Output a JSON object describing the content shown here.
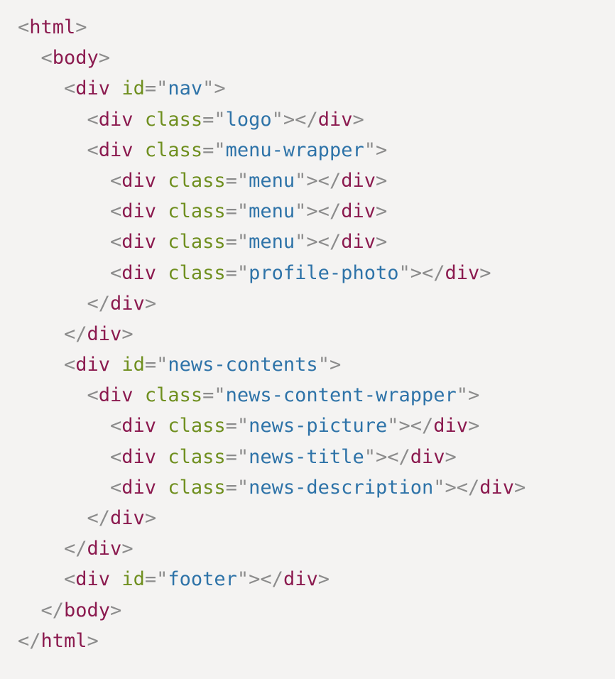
{
  "code": {
    "lines": [
      {
        "indent": 0,
        "tokens": [
          {
            "t": "<",
            "c": "punct"
          },
          {
            "t": "html",
            "c": "tag"
          },
          {
            "t": ">",
            "c": "punct"
          }
        ]
      },
      {
        "indent": 1,
        "tokens": [
          {
            "t": "<",
            "c": "punct"
          },
          {
            "t": "body",
            "c": "tag"
          },
          {
            "t": ">",
            "c": "punct"
          }
        ]
      },
      {
        "indent": 2,
        "tokens": [
          {
            "t": "<",
            "c": "punct"
          },
          {
            "t": "div",
            "c": "tag"
          },
          {
            "t": " ",
            "c": "punct"
          },
          {
            "t": "id",
            "c": "attr"
          },
          {
            "t": "=\"",
            "c": "punct"
          },
          {
            "t": "nav",
            "c": "val"
          },
          {
            "t": "\">",
            "c": "punct"
          }
        ]
      },
      {
        "indent": 3,
        "tokens": [
          {
            "t": "<",
            "c": "punct"
          },
          {
            "t": "div",
            "c": "tag"
          },
          {
            "t": " ",
            "c": "punct"
          },
          {
            "t": "class",
            "c": "attr"
          },
          {
            "t": "=\"",
            "c": "punct"
          },
          {
            "t": "logo",
            "c": "val"
          },
          {
            "t": "\"></",
            "c": "punct"
          },
          {
            "t": "div",
            "c": "tag"
          },
          {
            "t": ">",
            "c": "punct"
          }
        ]
      },
      {
        "indent": 3,
        "tokens": [
          {
            "t": "<",
            "c": "punct"
          },
          {
            "t": "div",
            "c": "tag"
          },
          {
            "t": " ",
            "c": "punct"
          },
          {
            "t": "class",
            "c": "attr"
          },
          {
            "t": "=\"",
            "c": "punct"
          },
          {
            "t": "menu-wrapper",
            "c": "val"
          },
          {
            "t": "\">",
            "c": "punct"
          }
        ]
      },
      {
        "indent": 4,
        "tokens": [
          {
            "t": "<",
            "c": "punct"
          },
          {
            "t": "div",
            "c": "tag"
          },
          {
            "t": " ",
            "c": "punct"
          },
          {
            "t": "class",
            "c": "attr"
          },
          {
            "t": "=\"",
            "c": "punct"
          },
          {
            "t": "menu",
            "c": "val"
          },
          {
            "t": "\"></",
            "c": "punct"
          },
          {
            "t": "div",
            "c": "tag"
          },
          {
            "t": ">",
            "c": "punct"
          }
        ]
      },
      {
        "indent": 4,
        "tokens": [
          {
            "t": "<",
            "c": "punct"
          },
          {
            "t": "div",
            "c": "tag"
          },
          {
            "t": " ",
            "c": "punct"
          },
          {
            "t": "class",
            "c": "attr"
          },
          {
            "t": "=\"",
            "c": "punct"
          },
          {
            "t": "menu",
            "c": "val"
          },
          {
            "t": "\"></",
            "c": "punct"
          },
          {
            "t": "div",
            "c": "tag"
          },
          {
            "t": ">",
            "c": "punct"
          }
        ]
      },
      {
        "indent": 4,
        "tokens": [
          {
            "t": "<",
            "c": "punct"
          },
          {
            "t": "div",
            "c": "tag"
          },
          {
            "t": " ",
            "c": "punct"
          },
          {
            "t": "class",
            "c": "attr"
          },
          {
            "t": "=\"",
            "c": "punct"
          },
          {
            "t": "menu",
            "c": "val"
          },
          {
            "t": "\"></",
            "c": "punct"
          },
          {
            "t": "div",
            "c": "tag"
          },
          {
            "t": ">",
            "c": "punct"
          }
        ]
      },
      {
        "indent": 4,
        "tokens": [
          {
            "t": "<",
            "c": "punct"
          },
          {
            "t": "div",
            "c": "tag"
          },
          {
            "t": " ",
            "c": "punct"
          },
          {
            "t": "class",
            "c": "attr"
          },
          {
            "t": "=\"",
            "c": "punct"
          },
          {
            "t": "profile-photo",
            "c": "val"
          },
          {
            "t": "\"></",
            "c": "punct"
          },
          {
            "t": "div",
            "c": "tag"
          },
          {
            "t": ">",
            "c": "punct"
          }
        ]
      },
      {
        "indent": 3,
        "tokens": [
          {
            "t": "</",
            "c": "punct"
          },
          {
            "t": "div",
            "c": "tag"
          },
          {
            "t": ">",
            "c": "punct"
          }
        ]
      },
      {
        "indent": 2,
        "tokens": [
          {
            "t": "</",
            "c": "punct"
          },
          {
            "t": "div",
            "c": "tag"
          },
          {
            "t": ">",
            "c": "punct"
          }
        ]
      },
      {
        "indent": 2,
        "tokens": [
          {
            "t": "<",
            "c": "punct"
          },
          {
            "t": "div",
            "c": "tag"
          },
          {
            "t": " ",
            "c": "punct"
          },
          {
            "t": "id",
            "c": "attr"
          },
          {
            "t": "=\"",
            "c": "punct"
          },
          {
            "t": "news-contents",
            "c": "val"
          },
          {
            "t": "\">",
            "c": "punct"
          }
        ]
      },
      {
        "indent": 3,
        "tokens": [
          {
            "t": "<",
            "c": "punct"
          },
          {
            "t": "div",
            "c": "tag"
          },
          {
            "t": " ",
            "c": "punct"
          },
          {
            "t": "class",
            "c": "attr"
          },
          {
            "t": "=\"",
            "c": "punct"
          },
          {
            "t": "news-content-wrapper",
            "c": "val"
          },
          {
            "t": "\">",
            "c": "punct"
          }
        ]
      },
      {
        "indent": 4,
        "tokens": [
          {
            "t": "<",
            "c": "punct"
          },
          {
            "t": "div",
            "c": "tag"
          },
          {
            "t": " ",
            "c": "punct"
          },
          {
            "t": "class",
            "c": "attr"
          },
          {
            "t": "=\"",
            "c": "punct"
          },
          {
            "t": "news-picture",
            "c": "val"
          },
          {
            "t": "\"></",
            "c": "punct"
          },
          {
            "t": "div",
            "c": "tag"
          },
          {
            "t": ">",
            "c": "punct"
          }
        ]
      },
      {
        "indent": 4,
        "tokens": [
          {
            "t": "<",
            "c": "punct"
          },
          {
            "t": "div",
            "c": "tag"
          },
          {
            "t": " ",
            "c": "punct"
          },
          {
            "t": "class",
            "c": "attr"
          },
          {
            "t": "=\"",
            "c": "punct"
          },
          {
            "t": "news-title",
            "c": "val"
          },
          {
            "t": "\"></",
            "c": "punct"
          },
          {
            "t": "div",
            "c": "tag"
          },
          {
            "t": ">",
            "c": "punct"
          }
        ]
      },
      {
        "indent": 4,
        "tokens": [
          {
            "t": "<",
            "c": "punct"
          },
          {
            "t": "div",
            "c": "tag"
          },
          {
            "t": " ",
            "c": "punct"
          },
          {
            "t": "class",
            "c": "attr"
          },
          {
            "t": "=\"",
            "c": "punct"
          },
          {
            "t": "news-description",
            "c": "val"
          },
          {
            "t": "\"></",
            "c": "punct"
          },
          {
            "t": "div",
            "c": "tag"
          },
          {
            "t": ">",
            "c": "punct"
          }
        ]
      },
      {
        "indent": 3,
        "tokens": [
          {
            "t": "</",
            "c": "punct"
          },
          {
            "t": "div",
            "c": "tag"
          },
          {
            "t": ">",
            "c": "punct"
          }
        ]
      },
      {
        "indent": 2,
        "tokens": [
          {
            "t": "</",
            "c": "punct"
          },
          {
            "t": "div",
            "c": "tag"
          },
          {
            "t": ">",
            "c": "punct"
          }
        ]
      },
      {
        "indent": 2,
        "tokens": [
          {
            "t": "<",
            "c": "punct"
          },
          {
            "t": "div",
            "c": "tag"
          },
          {
            "t": " ",
            "c": "punct"
          },
          {
            "t": "id",
            "c": "attr"
          },
          {
            "t": "=\"",
            "c": "punct"
          },
          {
            "t": "footer",
            "c": "val"
          },
          {
            "t": "\"></",
            "c": "punct"
          },
          {
            "t": "div",
            "c": "tag"
          },
          {
            "t": ">",
            "c": "punct"
          }
        ]
      },
      {
        "indent": 1,
        "tokens": [
          {
            "t": "</",
            "c": "punct"
          },
          {
            "t": "body",
            "c": "tag"
          },
          {
            "t": ">",
            "c": "punct"
          }
        ]
      },
      {
        "indent": 0,
        "tokens": [
          {
            "t": "</",
            "c": "punct"
          },
          {
            "t": "html",
            "c": "tag"
          },
          {
            "t": ">",
            "c": "punct"
          }
        ]
      }
    ]
  }
}
